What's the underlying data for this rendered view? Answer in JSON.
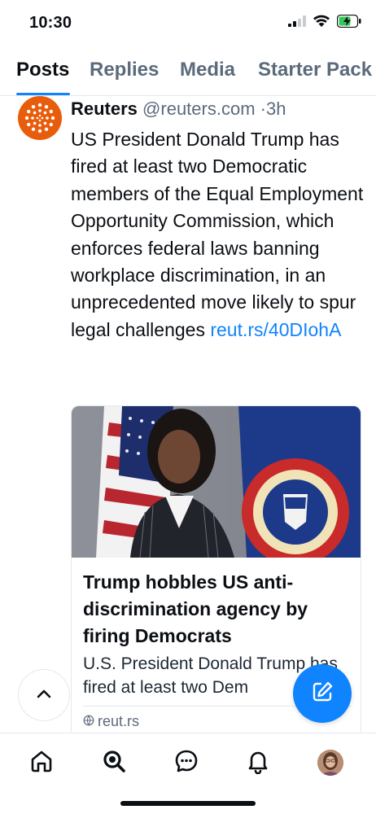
{
  "status_bar": {
    "time": "10:30",
    "icons": [
      "cellular-signal-icon",
      "wifi-icon",
      "battery-charging-icon"
    ]
  },
  "tabs": [
    {
      "label": "Posts",
      "active": true
    },
    {
      "label": "Replies",
      "active": false
    },
    {
      "label": "Media",
      "active": false
    },
    {
      "label": "Starter Pack",
      "active": false
    }
  ],
  "post": {
    "author_name": "Reuters",
    "author_handle": "@reuters.com",
    "separator": "·",
    "time_ago": "3h",
    "text": "US President Donald Trump has fired at least two Democratic members of the Equal Employment Opportunity Commission, which enforces federal laws banning workplace discrimination, in an unprecedented move likely to spur legal challenges",
    "link_text": "reut.rs/40DIohA",
    "embed": {
      "title": "Trump hobbles US anti-discrimination agency by firing Democrats",
      "description": "U.S. President Donald Trump has fired at least two Dem",
      "domain": "reut.rs",
      "image_alt": "Woman in pinstripe suit in front of US flag and EEOC flag"
    }
  },
  "floating": {
    "scroll_top_icon": "chevron-up-icon",
    "compose_icon": "compose-icon"
  },
  "bottom_nav": [
    {
      "icon": "home-icon"
    },
    {
      "icon": "search-icon"
    },
    {
      "icon": "chat-icon"
    },
    {
      "icon": "notifications-icon"
    },
    {
      "icon": "profile-avatar"
    }
  ],
  "colors": {
    "accent": "#1083fe",
    "reuters_orange": "#e85d0c",
    "secondary_text": "#5b6b7c"
  }
}
